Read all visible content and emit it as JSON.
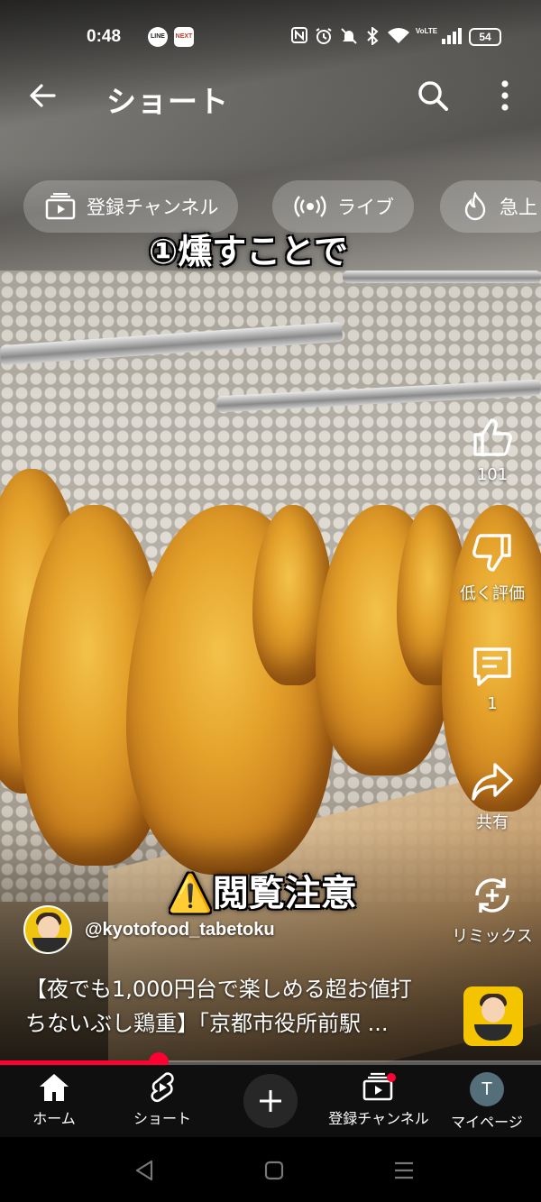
{
  "status_bar": {
    "time": "0:48",
    "notif_line": "LINE",
    "notif_app": "NEXT",
    "network": "VoLTE",
    "battery": "54"
  },
  "top_bar": {
    "title": "ショート"
  },
  "chips": [
    {
      "label": "登録チャンネル",
      "icon": "subscriptions-icon"
    },
    {
      "label": "ライブ",
      "icon": "live-icon"
    },
    {
      "label": "急上",
      "icon": "trending-icon"
    }
  ],
  "video_overlay": {
    "caption_top": "①燻すことで",
    "caption_warning": "⚠️閲覧注意"
  },
  "actions": {
    "like_count": "101",
    "dislike_label": "低く評価",
    "comment_count": "1",
    "share_label": "共有",
    "remix_label": "リミックス"
  },
  "channel": {
    "handle": "@kyotofood_tabetoku"
  },
  "description": {
    "line1": "【夜でも1,000円台で楽しめる超お値打",
    "line2": "ちないぶし鶏重】「京都市役所前駅 ..."
  },
  "progress": {
    "fraction": 0.293
  },
  "bottom_nav": {
    "home": "ホーム",
    "shorts": "ショート",
    "subscriptions": "登録チャンネル",
    "my_page": "マイページ",
    "avatar_letter": "T"
  },
  "colors": {
    "accent": "#ff0033",
    "nav_bg": "#0f0f0f"
  }
}
